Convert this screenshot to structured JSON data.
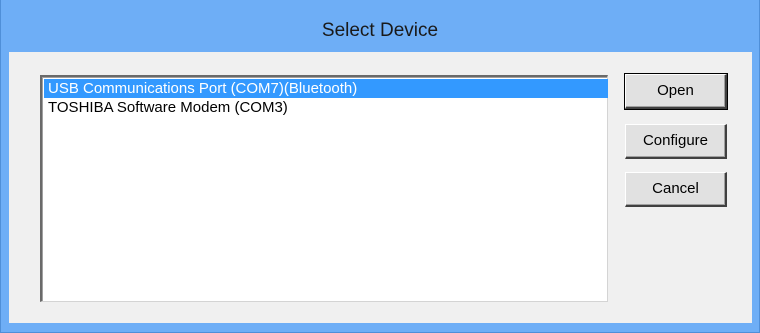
{
  "window": {
    "title": "Select Device"
  },
  "devices": {
    "items": [
      {
        "label": "USB Communications Port (COM7)(Bluetooth)",
        "selected": true
      },
      {
        "label": "TOSHIBA Software Modem (COM3)",
        "selected": false
      }
    ]
  },
  "buttons": {
    "open": "Open",
    "configure": "Configure",
    "cancel": "Cancel"
  },
  "colors": {
    "title_bar": "#6eaef6",
    "selection": "#3399ff",
    "dialog_background": "#f0f0f0"
  }
}
